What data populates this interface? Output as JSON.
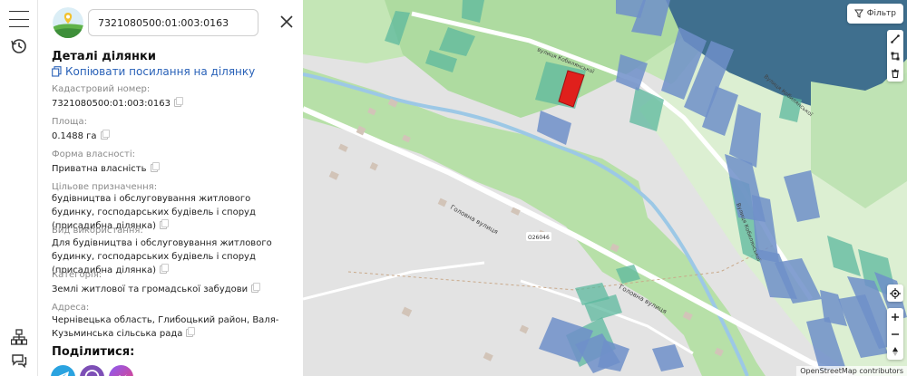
{
  "search": {
    "value": "7321080500:01:003:0163"
  },
  "panel": {
    "title": "Деталі ділянки",
    "copy_link": "Копіювати посилання на ділянку",
    "fields": [
      {
        "label": "Кадастровий номер:",
        "value": "7321080500:01:003:0163"
      },
      {
        "label": "Площа:",
        "value": "0.1488 га"
      },
      {
        "label": "Форма власності:",
        "value": "Приватна власність"
      },
      {
        "label": "Цільове призначення:",
        "value": "будівництва і обслуговування житлового будинку, господарських будівель і споруд (присадибна ділянка)"
      },
      {
        "label": "Вид використання:",
        "value": "Для будівництва і обслуговування житлового будинку, господарських будівель і споруд (присадибна ділянка)"
      },
      {
        "label": "Категорія:",
        "value": "Землі житлової та громадської забудови"
      },
      {
        "label": "Адреса:",
        "value": "Чернівецька область, Глибоцький район, Валя-Кузьминська сільська рада"
      }
    ],
    "share_title": "Поділитися:",
    "share": [
      {
        "name": "telegram",
        "color": "#2aa3e0"
      },
      {
        "name": "viber",
        "color": "#7d4fb6"
      },
      {
        "name": "messenger",
        "color": "#c040c8"
      }
    ]
  },
  "map": {
    "filter_label": "Фільтр",
    "street_labels": [
      "Головна вулиця",
      "Головна вулиця",
      "вулиця Кобилянської",
      "Вулиця Кобилянської",
      "Вулиця Кобилянської"
    ],
    "road_ref": "O26046",
    "attribution": "OpenStreetMap contributors",
    "colors": {
      "base": "#e3e3e3",
      "green": "#bfe3b4",
      "river": "#9cc8e6",
      "water": "#3f6f8e",
      "parcel_green": "#5cb89e",
      "parcel_blue": "#6e8fc9",
      "selected": "#e0201c"
    }
  },
  "icons": {
    "menu": "hamburger-icon",
    "history": "history-icon",
    "tree": "sitemap-icon",
    "chat": "chat-icon",
    "close": "close-icon",
    "copy": "copy-icon",
    "filter": "filter-icon",
    "draw_line": "draw-line-icon",
    "draw_polygon": "draw-polygon-icon",
    "delete": "trash-icon",
    "locate": "locate-icon",
    "zoom_in": "plus-icon",
    "zoom_out": "minus-icon",
    "compass": "compass-icon"
  }
}
